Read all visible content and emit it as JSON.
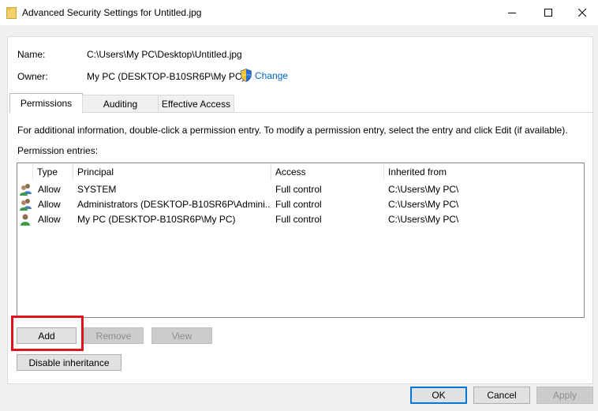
{
  "window": {
    "title": "Advanced Security Settings for Untitled.jpg"
  },
  "info": {
    "name_label": "Name:",
    "name_value": "C:\\Users\\My PC\\Desktop\\Untitled.jpg",
    "owner_label": "Owner:",
    "owner_value": "My PC (DESKTOP-B10SR6P\\My PC)",
    "change_link": "Change"
  },
  "tabs": [
    {
      "label": "Permissions",
      "active": true
    },
    {
      "label": "Auditing",
      "active": false
    },
    {
      "label": "Effective Access",
      "active": false
    }
  ],
  "permissions": {
    "info_text": "For additional information, double-click a permission entry. To modify a permission entry, select the entry and click Edit (if available).",
    "entries_label": "Permission entries:",
    "columns": [
      "Type",
      "Principal",
      "Access",
      "Inherited from"
    ],
    "rows": [
      {
        "icon": "users-group-icon",
        "type": "Allow",
        "principal": "SYSTEM",
        "access": "Full control",
        "inherited": "C:\\Users\\My PC\\"
      },
      {
        "icon": "users-group-icon",
        "type": "Allow",
        "principal": "Administrators (DESKTOP-B10SR6P\\Admini...",
        "access": "Full control",
        "inherited": "C:\\Users\\My PC\\"
      },
      {
        "icon": "user-icon",
        "type": "Allow",
        "principal": "My PC (DESKTOP-B10SR6P\\My PC)",
        "access": "Full control",
        "inherited": "C:\\Users\\My PC\\"
      }
    ]
  },
  "buttons": {
    "add": "Add",
    "remove": "Remove",
    "view": "View",
    "disable_inheritance": "Disable inheritance",
    "ok": "OK",
    "cancel": "Cancel",
    "apply": "Apply"
  },
  "colors": {
    "link": "#0066cc",
    "highlight": "#e0121c",
    "default_button_border": "#0078d7"
  }
}
